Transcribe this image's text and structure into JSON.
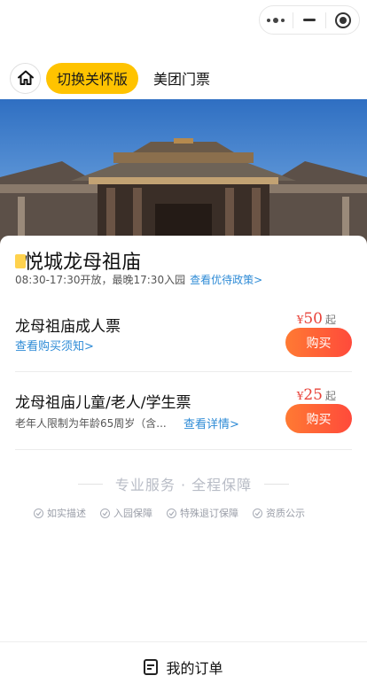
{
  "capsule": {
    "more_icon": "more-dots-icon",
    "minimize_icon": "minus-icon",
    "close_icon": "target-icon"
  },
  "nav": {
    "home_icon": "home-icon",
    "care_label": "切换关怀版",
    "title": "美团门票"
  },
  "attraction": {
    "name": "悦城龙母祖庙",
    "hours": "08:30-17:30开放，最晚17:30入园",
    "policy_link": "查看优待政策>"
  },
  "tickets": [
    {
      "name": "龙母祖庙成人票",
      "sub_link": "查看购买须知>",
      "currency": "¥",
      "price": "50",
      "suffix": "起",
      "buy_label": "购买"
    },
    {
      "name": "龙母祖庙儿童/老人/学生票",
      "sub_text": "老年人限制为年龄65周岁（含...",
      "sub_link": "查看详情>",
      "currency": "¥",
      "price": "25",
      "suffix": "起",
      "buy_label": "购买"
    }
  ],
  "service": {
    "title": "专业服务 · 全程保障",
    "items": [
      "如实描述",
      "入园保障",
      "特殊退订保障",
      "资质公示"
    ]
  },
  "bottom": {
    "icon": "order-list-icon",
    "label": "我的订单"
  },
  "colors": {
    "accent_yellow": "#ffc300",
    "link_blue": "#2e8bd6",
    "price_red": "#e8433a",
    "buy_gradient_start": "#ff7a33",
    "buy_gradient_end": "#ff4a3b"
  }
}
